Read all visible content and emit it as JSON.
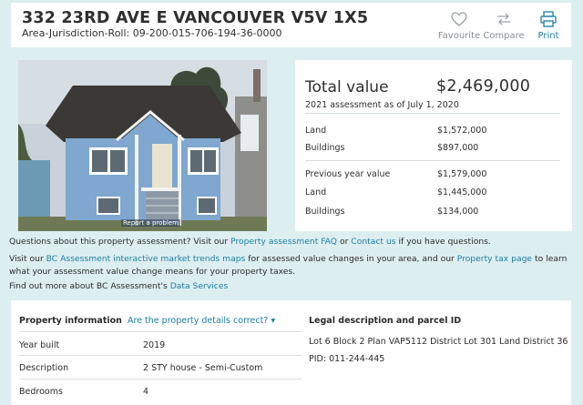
{
  "header": {
    "address": "332 23RD AVE E VANCOUVER V5V 1X5",
    "roll": "Area-Jurisdiction-Roll: 09-200-015-706-194-36-0000",
    "actions": {
      "favourite": "Favourite",
      "compare": "Compare",
      "print": "Print"
    }
  },
  "photo": {
    "report_link": "Report a problem"
  },
  "valuation": {
    "total_label": "Total value",
    "total_value": "$2,469,000",
    "subtitle": "2021 assessment as of July 1, 2020",
    "land_label": "Land",
    "land_value": "$1,572,000",
    "buildings_label": "Buildings",
    "buildings_value": "$897,000",
    "prev_label": "Previous year value",
    "prev_value": "$1,579,000",
    "prev_land_label": "Land",
    "prev_land_value": "$1,445,000",
    "prev_buildings_label": "Buildings",
    "prev_buildings_value": "$134,000"
  },
  "info": {
    "q_text1": "Questions about this property assessment? Visit our ",
    "q_link1": "Property assessment FAQ",
    "q_text2": " or ",
    "q_link2": "Contact us",
    "q_text3": " if you have questions.",
    "v_text1": "Visit our ",
    "v_link1": "BC Assessment interactive market trends maps",
    "v_text2": " for assessed value changes in your area, and our ",
    "v_link2": "Property tax page",
    "v_text3": " to learn what your assessment value change means for your property taxes.",
    "f_text1": "Find out more about BC Assessment's ",
    "f_link1": "Data Services"
  },
  "property": {
    "heading": "Property information",
    "correct_link": "Are the property details correct? ▾",
    "year_label": "Year built",
    "year_value": "2019",
    "desc_label": "Description",
    "desc_value": "2 STY house - Semi-Custom",
    "bed_label": "Bedrooms",
    "bed_value": "4"
  },
  "legal": {
    "heading": "Legal description and parcel ID",
    "description": "Lot 6 Block 2 Plan VAP5112 District Lot 301 Land District 36",
    "pid": "PID: 011-244-445"
  }
}
